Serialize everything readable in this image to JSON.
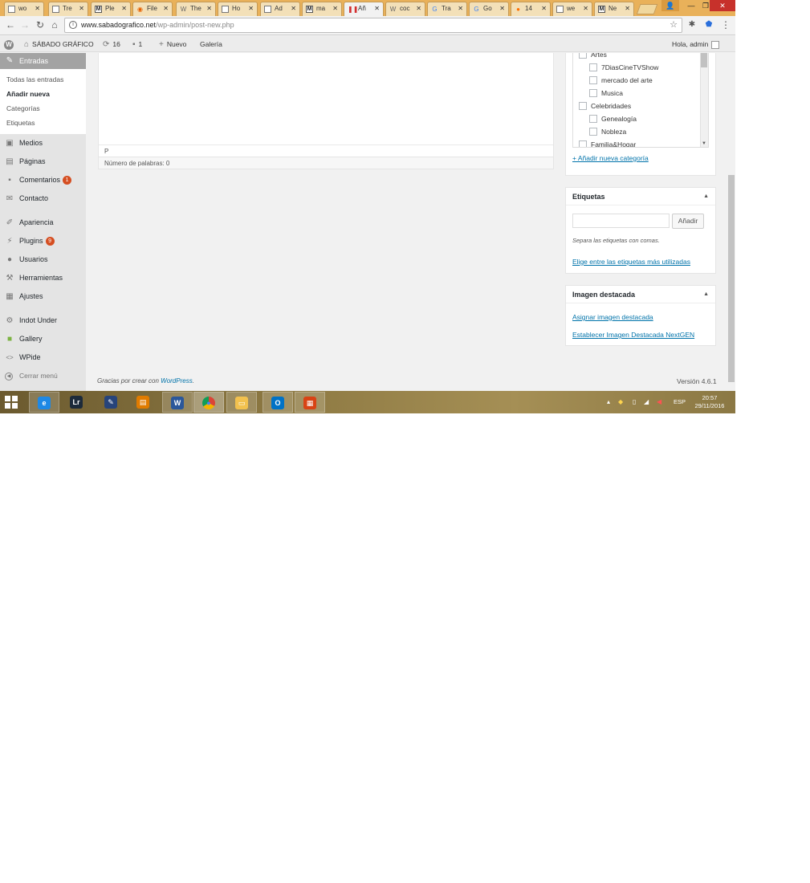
{
  "browser": {
    "tabs": [
      {
        "icon": "doc",
        "label": "wo"
      },
      {
        "icon": "doc",
        "label": "Tre"
      },
      {
        "icon": "m",
        "label": "Ple"
      },
      {
        "icon": "firefox",
        "label": "File"
      },
      {
        "icon": "wp",
        "label": "The"
      },
      {
        "icon": "doc",
        "label": "Ho"
      },
      {
        "icon": "doc",
        "label": "Ad"
      },
      {
        "icon": "m",
        "label": "ma"
      },
      {
        "icon": "pause",
        "label": "Añ"
      },
      {
        "icon": "wp",
        "label": "coc"
      },
      {
        "icon": "translate",
        "label": "Tra"
      },
      {
        "icon": "google",
        "label": "Go"
      },
      {
        "icon": "orange",
        "label": "14"
      },
      {
        "icon": "doc",
        "label": "we"
      },
      {
        "icon": "m",
        "label": "Ne"
      }
    ],
    "active_tab_index": 8,
    "tab_close_glyph": "✕",
    "url_host": "www.sabadografico.net",
    "url_path": "/wp-admin/post-new.php"
  },
  "adminbar": {
    "site_name": "SÁBADO GRÁFICO",
    "updates_count": "16",
    "comments_count": "1",
    "new_label": "Nuevo",
    "gallery_label": "Galería",
    "greeting": "Hola, admin"
  },
  "sidebar": {
    "current_menu": "Entradas",
    "submenu": [
      "Todas las entradas",
      "Añadir nueva",
      "Categorías",
      "Etiquetas"
    ],
    "current_sub_index": 1,
    "items": [
      {
        "label": "Medios",
        "icon": "media-icon"
      },
      {
        "label": "Páginas",
        "icon": "pages-icon"
      },
      {
        "label": "Comentarios",
        "icon": "comments-icon",
        "badge": "1"
      },
      {
        "label": "Contacto",
        "icon": "mail-icon"
      },
      {
        "separator": true
      },
      {
        "label": "Apariencia",
        "icon": "brush-icon"
      },
      {
        "label": "Plugins",
        "icon": "plugin-icon",
        "badge": "9"
      },
      {
        "label": "Usuarios",
        "icon": "users-icon"
      },
      {
        "label": "Herramientas",
        "icon": "wrench-icon"
      },
      {
        "label": "Ajustes",
        "icon": "settings-icon"
      },
      {
        "separator": true
      },
      {
        "label": "Indot Under",
        "icon": "gear-icon"
      },
      {
        "label": "Gallery",
        "icon": "gallery-icon"
      },
      {
        "label": "WPide",
        "icon": "code-icon"
      }
    ],
    "collapse_label": "Cerrar menú"
  },
  "editor": {
    "path_label": "P",
    "word_count": "Número de palabras: 0"
  },
  "categories": {
    "items": [
      {
        "label": "Artes",
        "level": 0
      },
      {
        "label": "7DiasCineTVShow",
        "level": 1
      },
      {
        "label": "mercado del arte",
        "level": 1
      },
      {
        "label": "Musica",
        "level": 1
      },
      {
        "label": "Celebridades",
        "level": 0
      },
      {
        "label": "Genealogía",
        "level": 1
      },
      {
        "label": "Nobleza",
        "level": 1
      },
      {
        "label": "Familia&Hogar",
        "level": 0
      }
    ],
    "add_link": "+ Añadir nueva categoría"
  },
  "tags_box": {
    "title": "Etiquetas",
    "input_value": "",
    "add_button": "Añadir",
    "hint": "Separa las etiquetas con comas.",
    "popular_link": "Elige entre las etiquetas más utilizadas"
  },
  "featured_box": {
    "title": "Imagen destacada",
    "assign_link": "Asignar imagen destacada",
    "nextgen_link": "Establecer Imagen Destacada NextGEN"
  },
  "footer": {
    "thanks_prefix": "Gracias por crear con ",
    "thanks_link": "WordPress",
    "thanks_suffix": ".",
    "version": "Versión 4.6.1"
  },
  "taskbar": {
    "apps": [
      {
        "name": "internet-explorer",
        "glyph": "e",
        "color": "#1e88e5"
      },
      {
        "name": "lightroom",
        "glyph": "Lr",
        "color": "#1c2a3a"
      },
      {
        "name": "app-feather",
        "glyph": "✎",
        "color": "#27447a"
      },
      {
        "name": "app-orange",
        "glyph": "▤",
        "color": "#e07b00"
      },
      {
        "name": "word",
        "glyph": "W",
        "color": "#2b579a"
      },
      {
        "name": "chrome",
        "glyph": "●",
        "color": "#db4437"
      },
      {
        "name": "file-explorer",
        "glyph": "▭",
        "color": "#f2c14e"
      },
      {
        "name": "outlook",
        "glyph": "O",
        "color": "#0072c6"
      },
      {
        "name": "app-red",
        "glyph": "▦",
        "color": "#d84315"
      }
    ],
    "active_app_index": 5,
    "language": "ESP",
    "time": "20:57",
    "date": "29/11/2016"
  }
}
